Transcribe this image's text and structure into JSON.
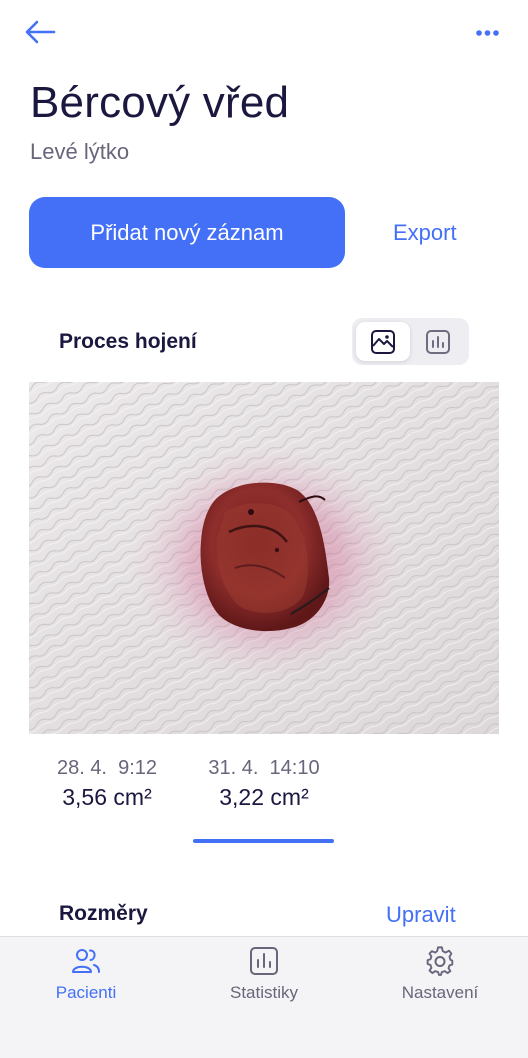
{
  "colors": {
    "accent": "#4370f7",
    "text": "#1b1840",
    "muted": "#67667b",
    "nav_bg": "#f4f4f6"
  },
  "header": {
    "back_icon": "arrow-left-icon",
    "more_icon": "more-horizontal-icon"
  },
  "wound": {
    "title": "Bércový vřed",
    "location": "Levé lýtko"
  },
  "actions": {
    "add_record": "Přidat nový záznam",
    "export": "Export"
  },
  "healing": {
    "title": "Proces hojení",
    "views": [
      "image-view-icon",
      "chart-view-icon"
    ],
    "active_view": "image",
    "photo_icon": "wound-photo",
    "entries": [
      {
        "time": "28. 4.  9:12",
        "area": "3,56 cm²"
      },
      {
        "time": "31. 4.  14:10",
        "area": "3,22 cm²"
      }
    ]
  },
  "dimensions": {
    "title": "Rozměry",
    "edit": "Upravit"
  },
  "nav": [
    {
      "label": "Pacienti",
      "icon": "users-icon",
      "active": true
    },
    {
      "label": "Statistiky",
      "icon": "bar-chart-icon",
      "active": false
    },
    {
      "label": "Nastavení",
      "icon": "gear-icon",
      "active": false
    }
  ]
}
